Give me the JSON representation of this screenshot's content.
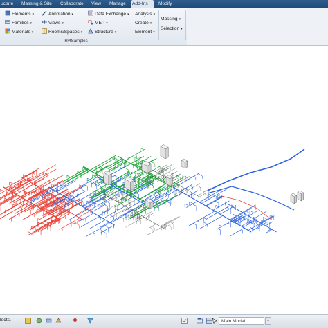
{
  "tabs": [
    "ucture",
    "Massing & Site",
    "Collaborate",
    "View",
    "Manage",
    "Add-Ins",
    "Modify"
  ],
  "active_tab": "Add-Ins",
  "ribbon": {
    "col1": [
      "Elements",
      "Families",
      "Materials"
    ],
    "col2": [
      "Annotation",
      "Views",
      "Rooms/Spaces"
    ],
    "col3": [
      "Data Exchange",
      "MEP",
      "Structure"
    ],
    "col4": [
      "Analysis",
      "Create",
      "Element"
    ],
    "col5": [
      "Massing",
      "Selection"
    ],
    "panel_title": "RvtSamples"
  },
  "status": {
    "left_text": "lects.",
    "workset": "Main Model"
  },
  "colors": {
    "duct_red": "#e8463c",
    "pipe_blue": "#2a62e0",
    "duct_green": "#1fa33a",
    "equipment_gray": "#8a8a8a",
    "tab_bar": "#2a5585"
  },
  "icons": {
    "elements": "elements-icon",
    "families": "families-icon",
    "materials": "materials-icon",
    "annotation": "annotation-icon",
    "views": "views-icon",
    "rooms": "rooms-spaces-icon",
    "data_exchange": "data-exchange-icon",
    "mep": "mep-icon",
    "structure": "structure-icon"
  }
}
